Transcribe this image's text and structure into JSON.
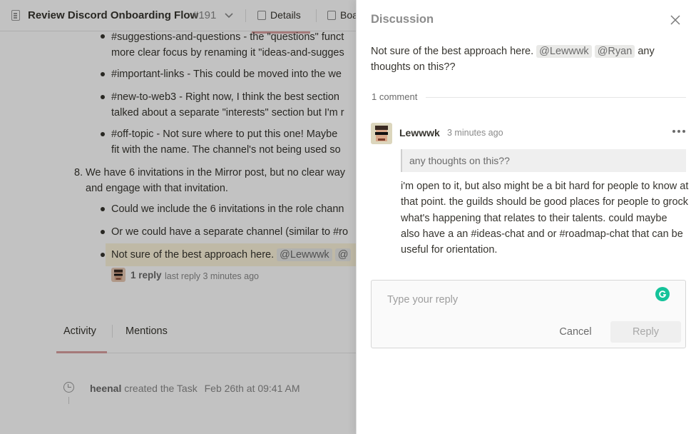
{
  "header": {
    "task_title": "Review Discord Onboarding Flow",
    "task_number": "#191",
    "tabs": [
      {
        "label": "Details"
      },
      {
        "label": "Boa"
      }
    ]
  },
  "content": {
    "lines": [
      "#suggestions-and-questions - the \"questions\" funct",
      "more clear focus by renaming it \"ideas-and-sugges",
      "#important-links - This could be moved into the we",
      "#new-to-web3 - Right now, I think the best section",
      "talked about a separate \"interests\" section but I'm r",
      "#off-topic - Not sure where to put this one! Maybe",
      "fit with the name. The channel's not being used so",
      "We have 6 invitations in the Mirror post, but no clear way",
      "and engage with that invitation.",
      "Could we include the 6 invitations in the role chann",
      "Or we could have a separate channel (similar to #ro"
    ],
    "ordered_number": "8.",
    "highlight_text": "Not sure of the best approach here.",
    "highlight_mention_1": "@Lewwwk",
    "highlight_mention_2": "@",
    "reply_count": "1 reply",
    "last_reply": "last reply 3 minutes ago"
  },
  "activity": {
    "tabs": [
      {
        "label": "Activity"
      },
      {
        "label": "Mentions"
      }
    ],
    "entry": {
      "user": "heenal",
      "action": "created the Task",
      "time": "Feb 26th at 09:41 AM"
    }
  },
  "discussion": {
    "title": "Discussion",
    "quote": {
      "text": "Not sure of the best approach here.",
      "mention_1": "@Lewwwk",
      "mention_2": "@Ryan",
      "tail": "any thoughts on this??"
    },
    "comment_count": "1 comment",
    "comment": {
      "author": "Lewwwk",
      "time": "3 minutes ago",
      "quoted": "any thoughts on this??",
      "body": "i'm open to it, but also might be a bit hard for people to know at that point. the guilds should be good places for people to grock what's happening that relates to their talents. could maybe also have a an #ideas-chat and or #roadmap-chat that can be useful for orientation."
    },
    "reply": {
      "placeholder": "Type your reply",
      "value": "",
      "cancel_label": "Cancel",
      "submit_label": "Reply"
    }
  },
  "colors": {
    "accent_underline": "#d9a0a0",
    "highlight": "#fbf3db",
    "grammarly": "#15c39a"
  },
  "icons": [
    "doc-icon",
    "chevron-down-icon",
    "details-icon",
    "board-icon",
    "clock-icon",
    "close-icon",
    "more-icon",
    "grammarly-icon"
  ]
}
